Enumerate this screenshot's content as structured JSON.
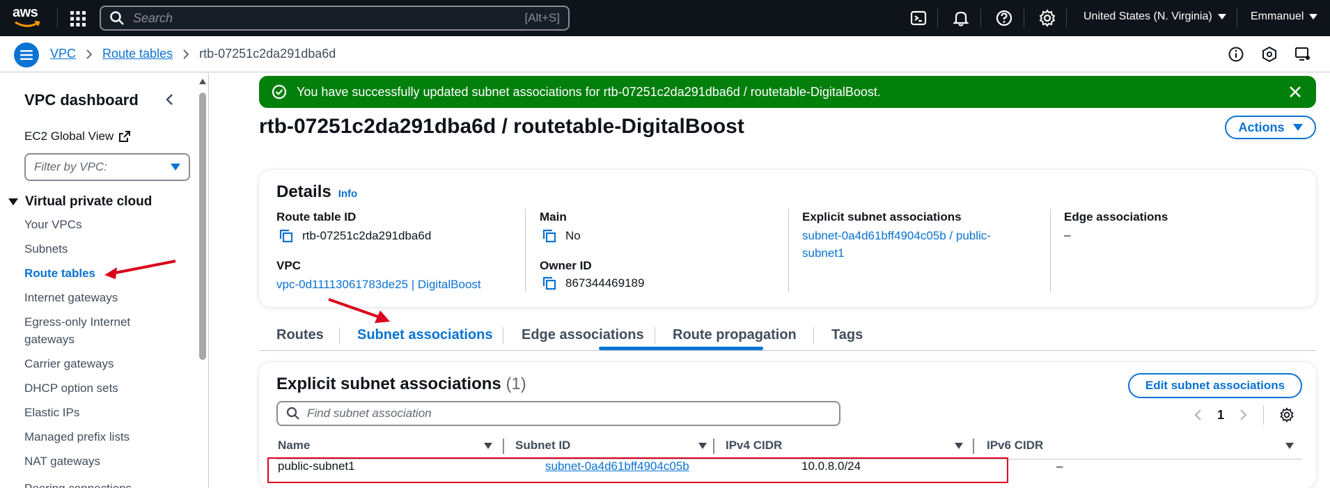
{
  "topnav": {
    "logo": "aws",
    "search_placeholder": "Search",
    "search_shortcut": "[Alt+S]",
    "region": "United States (N. Virginia)",
    "user": "Emmanuel"
  },
  "breadcrumb": {
    "items": [
      "VPC",
      "Route tables"
    ],
    "current": "rtb-07251c2da291dba6d"
  },
  "sidebar": {
    "title": "VPC dashboard",
    "ec2_global_view": "EC2 Global View",
    "filter_placeholder": "Filter by VPC:",
    "section": "Virtual private cloud",
    "items": [
      "Your VPCs",
      "Subnets",
      "Route tables",
      "Internet gateways",
      "Egress-only Internet gateways",
      "Carrier gateways",
      "DHCP option sets",
      "Elastic IPs",
      "Managed prefix lists",
      "NAT gateways",
      "Peering connections"
    ],
    "active_item": "Route tables"
  },
  "flash": {
    "message": "You have successfully updated subnet associations for rtb-07251c2da291dba6d / routetable-DigitalBoost."
  },
  "page": {
    "title": "rtb-07251c2da291dba6d / routetable-DigitalBoost",
    "actions_label": "Actions"
  },
  "details": {
    "heading": "Details",
    "info": "Info",
    "route_table_id_label": "Route table ID",
    "route_table_id": "rtb-07251c2da291dba6d",
    "vpc_label": "VPC",
    "vpc": "vpc-0d11113061783de25 | DigitalBoost",
    "main_label": "Main",
    "main": "No",
    "owner_id_label": "Owner ID",
    "owner_id": "867344469189",
    "explicit_label": "Explicit subnet associations",
    "explicit_line1": "subnet-0a4d61bff4904c05b / public-",
    "explicit_line2": "subnet1",
    "edge_label": "Edge associations",
    "edge": "–"
  },
  "tabs": [
    "Routes",
    "Subnet associations",
    "Edge associations",
    "Route propagation",
    "Tags"
  ],
  "active_tab": "Subnet associations",
  "subnet_table": {
    "heading": "Explicit subnet associations",
    "count": "(1)",
    "edit_button": "Edit subnet associations",
    "find_placeholder": "Find subnet association",
    "page": "1",
    "columns": [
      "Name",
      "Subnet ID",
      "IPv4 CIDR",
      "IPv6 CIDR"
    ],
    "rows": [
      {
        "name": "public-subnet1",
        "subnet_id": "subnet-0a4d61bff4904c05b",
        "ipv4": "10.0.8.0/24",
        "ipv6": "–"
      }
    ]
  },
  "colors": {
    "accent": "#0972d3",
    "success": "#037f0c",
    "nav_bg": "#0f141a",
    "annotation_red": "#d9001b"
  }
}
